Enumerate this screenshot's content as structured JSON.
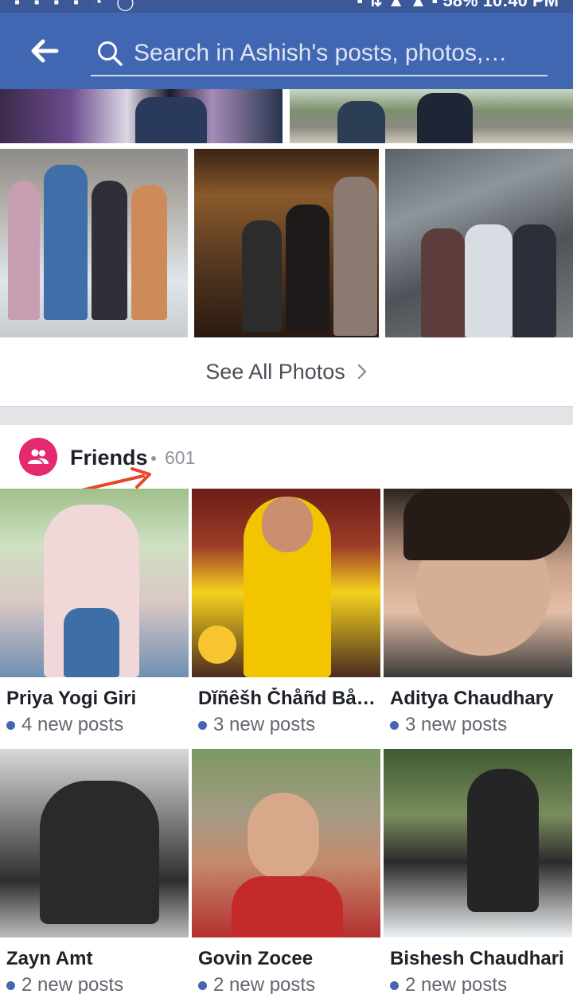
{
  "status_bar": {
    "left_icons": "▪ ▪ ▪ ▪ ◔ ◯",
    "right_text": "▪ ⇅ ▲ ▲ ▪ 58%  10:40 PM"
  },
  "app_bar": {
    "background": "#4267b2",
    "back_icon": "arrow-left-icon",
    "search_icon": "search-icon",
    "search_placeholder": "Search in Ashish's posts, photos,…"
  },
  "photos": {
    "see_all_label": "See All Photos",
    "chevron_icon": "chevron-right-icon"
  },
  "friends": {
    "icon": "friends-icon",
    "accent": "#e4296f",
    "title": "Friends",
    "count": "601",
    "items": [
      {
        "name": "Priya Yogi Giri",
        "posts": "4 new posts"
      },
      {
        "name": "Dĭñêšh Čhåñd Båt…",
        "posts": "3 new posts"
      },
      {
        "name": "Aditya Chaudhary",
        "posts": "3 new posts"
      },
      {
        "name": "Zayn  Amt",
        "posts": "2 new posts"
      },
      {
        "name": "Govin Zocee",
        "posts": "2 new posts"
      },
      {
        "name": "Bishesh Chaudhari",
        "posts": "2 new posts"
      }
    ]
  },
  "annotation": {
    "arrow_color": "#e8462a"
  }
}
